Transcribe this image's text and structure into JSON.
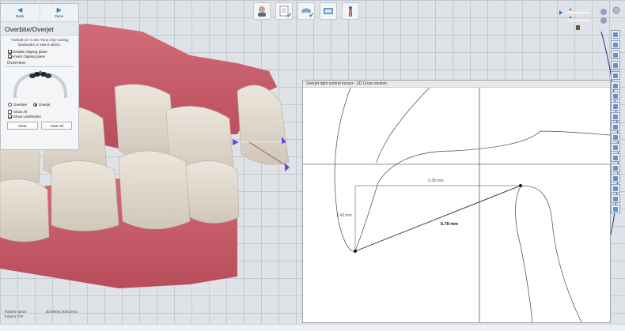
{
  "nav": {
    "back_label": "Back",
    "done_label": "Done"
  },
  "panel": {
    "title": "Overbite/Overjet",
    "info": "\"Overjet 11\" is set. Tune it by moving landmarks or select others.",
    "enable_clipping": "Enable clipping plane",
    "invert_clipping": "Invert clipping plane",
    "overview_label": "Overview",
    "overbite_label": "Overbite",
    "overjet_label": "Overjet",
    "show_all": "Show All",
    "show_landmarks": "Show Landmarks",
    "clear_label": "Clear",
    "clear_all_label": "Clear all",
    "checks": {
      "enable_clipping": true,
      "invert_clipping": true,
      "show_all": false,
      "show_landmarks": true
    },
    "selected_mode": "overjet"
  },
  "toolbar": {
    "icons": [
      "patient-icon",
      "clipboard-check-icon",
      "jaw-scan-icon",
      "bite-check-icon",
      "figure-icon"
    ]
  },
  "cross_section": {
    "title": "Overjet right central incisor - 2D Cross section",
    "horizontal_distance": "6.35 mm",
    "vertical_distance": "2.43 mm",
    "diagonal_distance": "6.78 mm"
  },
  "status": {
    "patient_name_label": "Patient name:",
    "patient_name_value": "3DEMent 3DEDemo",
    "patient_id_label": "Patient 'ON'"
  },
  "colors": {
    "accent": "#1c7ed6",
    "gum": "#c85f6c",
    "tooth": "#e3dcd0",
    "marker": "#6a4bd8"
  }
}
